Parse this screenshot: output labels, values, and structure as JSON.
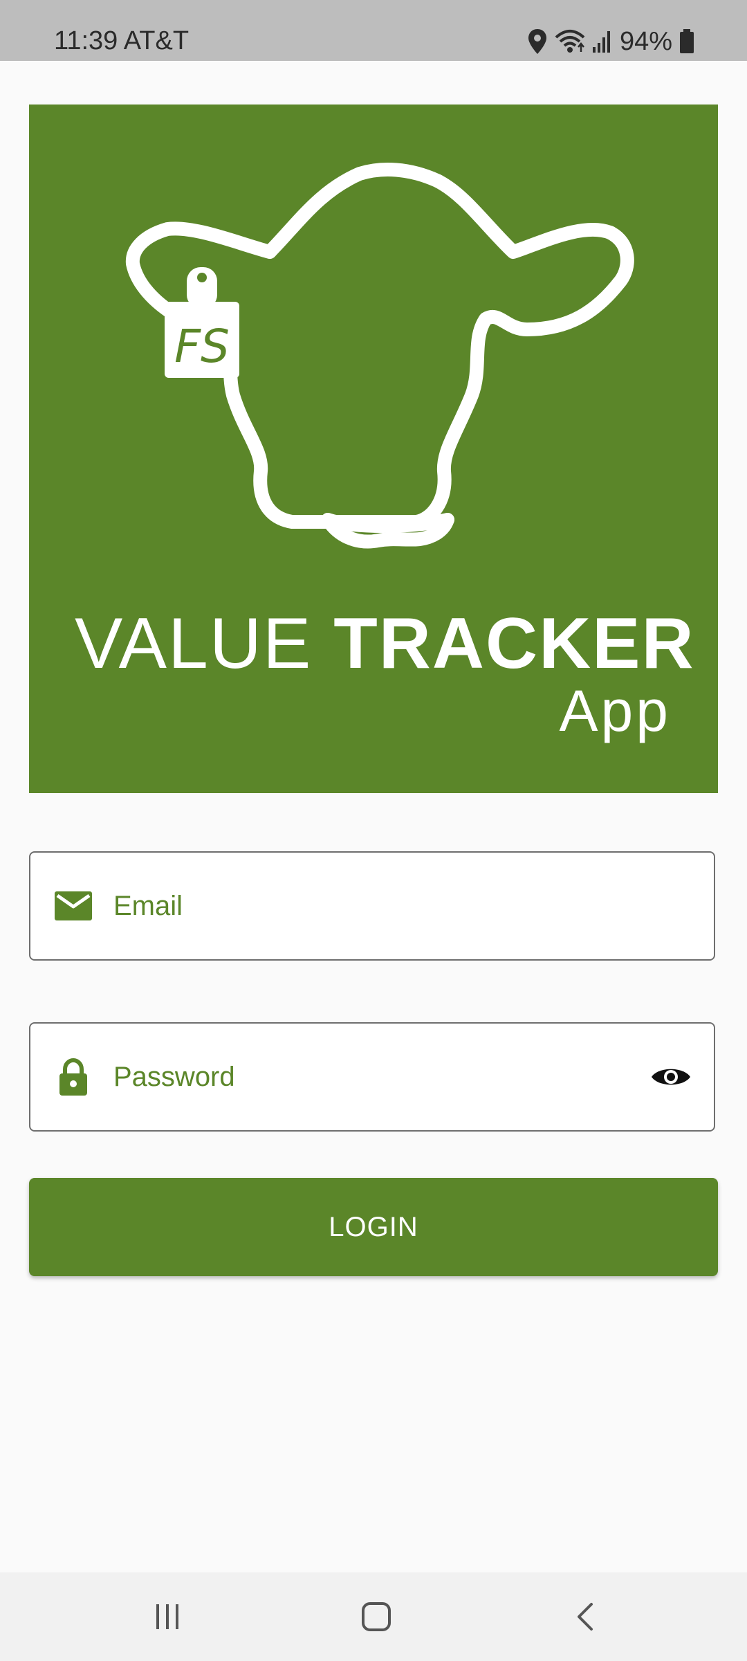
{
  "status_bar": {
    "time": "11:39",
    "carrier": "AT&T",
    "battery": "94%",
    "icons": [
      "location-icon",
      "wifi-icon",
      "signal-icon",
      "battery-icon"
    ]
  },
  "hero": {
    "title_light": "VALUE ",
    "title_bold": "TRACKER",
    "subtitle": "App",
    "tag_text": "FS",
    "background_color": "#5b8629",
    "icon": "cow-head-icon"
  },
  "form": {
    "email": {
      "placeholder": "Email",
      "value": "",
      "icon": "mail-icon"
    },
    "password": {
      "placeholder": "Password",
      "value": "",
      "icon": "lock-icon",
      "toggle_icon": "eye-icon"
    },
    "login_label": "LOGIN"
  },
  "colors": {
    "accent": "#5b8629",
    "background": "#fafafa"
  },
  "nav_bar": {
    "items": [
      "recents-icon",
      "home-icon",
      "back-icon"
    ]
  }
}
